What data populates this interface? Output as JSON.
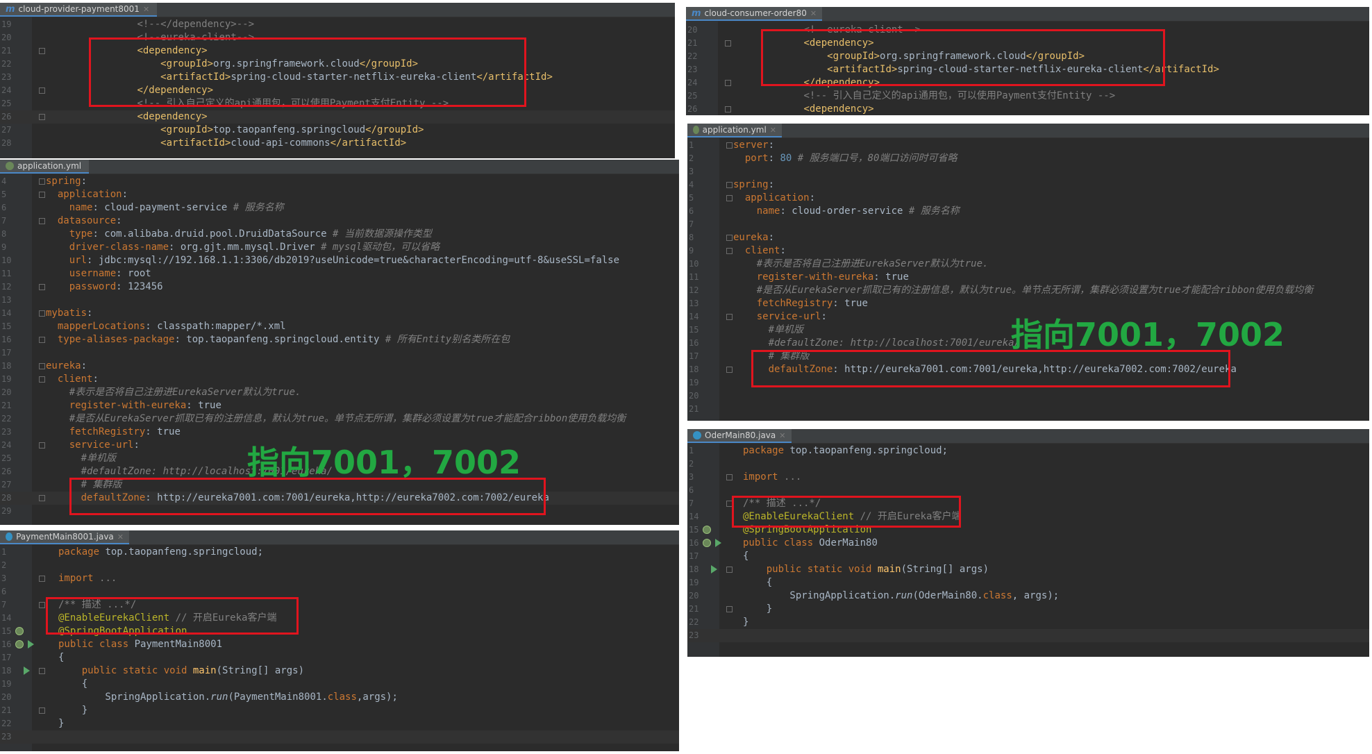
{
  "tabs": {
    "p1": "cloud-provider-payment8001",
    "p2": "application.yml",
    "p3": "PaymentMain8001.java",
    "p4": "cloud-consumer-order80",
    "p5": "application.yml",
    "p6": "OderMain80.java"
  },
  "overlay_text": "指向7001，7002",
  "colors": {
    "highlight_box": "#e0141e",
    "overlay_text": "#22a842",
    "editor_bg": "#2b2b2b"
  },
  "panels": {
    "pom_provider": [
      {
        "n": "19",
        "html": "        <span class=\"c\">&lt;!--&lt;/dependency&gt;--&gt;</span>"
      },
      {
        "n": "20",
        "html": "        <span class=\"c\">&lt;!--eureka-client--&gt;</span>"
      },
      {
        "n": "21",
        "html": "        <span class=\"t\">&lt;dependency&gt;</span>",
        "fold": true
      },
      {
        "n": "22",
        "html": "            <span class=\"t\">&lt;groupId&gt;</span>org.springframework.cloud<span class=\"t\">&lt;/groupId&gt;</span>"
      },
      {
        "n": "23",
        "html": "            <span class=\"t\">&lt;artifactId&gt;</span>spring-cloud-starter-netflix-eureka-client<span class=\"t\">&lt;/artifactId&gt;</span>"
      },
      {
        "n": "24",
        "html": "        <span class=\"t\">&lt;/dependency&gt;</span>",
        "fold": true
      },
      {
        "n": "25",
        "html": "        <span class=\"c\">&lt;!-- 引入自己定义的api通用包，可以使用Payment支付Entity --&gt;</span>"
      },
      {
        "n": "26",
        "html": "        <span class=\"t\">&lt;dependency&gt;</span>",
        "fold": true,
        "hl": true
      },
      {
        "n": "27",
        "html": "            <span class=\"t\">&lt;groupId&gt;</span>top.taopanfeng.springcloud<span class=\"t\">&lt;/groupId&gt;</span>"
      },
      {
        "n": "28",
        "html": "            <span class=\"t\">&lt;artifactId&gt;</span>cloud-api-commons<span class=\"t\">&lt;/artifactId&gt;</span>"
      }
    ],
    "yml_provider": [
      {
        "n": "4",
        "html": "<span class=\"a\">spring</span>:",
        "fold": true
      },
      {
        "n": "5",
        "html": "  <span class=\"a\">application</span>:",
        "fold": true
      },
      {
        "n": "6",
        "html": "    <span class=\"a\">name</span>: cloud-payment-service <span class=\"c it\"># 服务名称</span>"
      },
      {
        "n": "7",
        "html": "  <span class=\"a\">datasource</span>:",
        "fold": true
      },
      {
        "n": "8",
        "html": "    <span class=\"a\">type</span>: com.alibaba.druid.pool.DruidDataSource <span class=\"c it\"># 当前数据源操作类型</span>"
      },
      {
        "n": "9",
        "html": "    <span class=\"a\">driver-class-name</span>: org.gjt.mm.mysql.Driver <span class=\"c it\"># mysql驱动包，可以省略</span>"
      },
      {
        "n": "10",
        "html": "    <span class=\"a\">url</span>: jdbc:mysql://192.168.1.1:3306/db2019?useUnicode=true&amp;characterEncoding=utf-8&amp;useSSL=false"
      },
      {
        "n": "11",
        "html": "    <span class=\"a\">username</span>: root"
      },
      {
        "n": "12",
        "html": "    <span class=\"a\">password</span>: 123456",
        "fold": true
      },
      {
        "n": "13",
        "html": ""
      },
      {
        "n": "14",
        "html": "<span class=\"a\">mybatis</span>:",
        "fold": true
      },
      {
        "n": "15",
        "html": "  <span class=\"a\">mapperLocations</span>: classpath:mapper/*.xml"
      },
      {
        "n": "16",
        "html": "  <span class=\"a\">type-aliases-package</span>: top.taopanfeng.springcloud.entity <span class=\"c it\"># 所有Entity别名类所在包</span>",
        "fold": true
      },
      {
        "n": "17",
        "html": ""
      },
      {
        "n": "18",
        "html": "<span class=\"a\">eureka</span>:",
        "fold": true
      },
      {
        "n": "19",
        "html": "  <span class=\"a\">client</span>:",
        "fold": true
      },
      {
        "n": "20",
        "html": "    <span class=\"c it\">#表示是否将自己注册进EurekaServer默认为true.</span>"
      },
      {
        "n": "21",
        "html": "    <span class=\"a\">register-with-eureka</span>: true"
      },
      {
        "n": "22",
        "html": "    <span class=\"c it\">#是否从EurekaServer抓取已有的注册信息，默认为true。单节点无所谓，集群必须设置为true才能配合ribbon使用负载均衡</span>"
      },
      {
        "n": "23",
        "html": "    <span class=\"a\">fetchRegistry</span>: true"
      },
      {
        "n": "24",
        "html": "    <span class=\"a\">service-url</span>:",
        "fold": true
      },
      {
        "n": "25",
        "html": "      <span class=\"c it\">#单机版</span>"
      },
      {
        "n": "26",
        "html": "      <span class=\"c it\">#defaultZone: http://localhost:7001/eureka/</span>"
      },
      {
        "n": "27",
        "html": "      <span class=\"c it\"># 集群版</span>"
      },
      {
        "n": "28",
        "html": "      <span class=\"a\">defaultZone</span>: http://eureka7001.com:7001/eureka,http://eureka7002.com:7002/eureka",
        "fold": true,
        "hl": true
      },
      {
        "n": "29",
        "html": ""
      }
    ],
    "java_provider": [
      {
        "n": "1",
        "html": "<span class=\"k\">package</span> top.taopanfeng.springcloud;"
      },
      {
        "n": "2",
        "html": ""
      },
      {
        "n": "3",
        "html": "<span class=\"k\">import</span> <span class=\"c\">...</span>",
        "fold": true
      },
      {
        "n": "6",
        "html": ""
      },
      {
        "n": "7",
        "html": "<span class=\"c\">/** 描述 ...*/</span>",
        "fold": true
      },
      {
        "n": "14",
        "html": "<span class=\"y\">@EnableEurekaClient</span> <span class=\"c\">// 开启Eureka客户端</span>"
      },
      {
        "n": "15",
        "html": "<span class=\"y\">@SpringBootApplication</span>",
        "spring": true
      },
      {
        "n": "16",
        "html": "<span class=\"k\">public class</span> PaymentMain8001",
        "spring": true,
        "run": true
      },
      {
        "n": "17",
        "html": "{"
      },
      {
        "n": "18",
        "html": "    <span class=\"k\">public static void</span> <span class=\"fn\">main</span>(String[] args)",
        "run": true,
        "fold": true
      },
      {
        "n": "19",
        "html": "    {"
      },
      {
        "n": "20",
        "html": "        SpringApplication.<span class=\"it\">run</span>(PaymentMain8001.<span class=\"k\">class</span>,args);"
      },
      {
        "n": "21",
        "html": "    }",
        "fold": true
      },
      {
        "n": "22",
        "html": "}"
      },
      {
        "n": "23",
        "html": "",
        "hl": true
      }
    ],
    "pom_consumer": [
      {
        "n": "20",
        "html": "        <span class=\"c\">&lt;!--eureka-client--&gt;</span>"
      },
      {
        "n": "21",
        "html": "        <span class=\"t\">&lt;dependency&gt;</span>",
        "fold": true
      },
      {
        "n": "22",
        "html": "            <span class=\"t\">&lt;groupId&gt;</span>org.springframework.cloud<span class=\"t\">&lt;/groupId&gt;</span>"
      },
      {
        "n": "23",
        "html": "            <span class=\"t\">&lt;artifactId&gt;</span>spring-cloud-starter-netflix-eureka-client<span class=\"t\">&lt;/artifactId&gt;</span>"
      },
      {
        "n": "24",
        "html": "        <span class=\"t\">&lt;/dependency&gt;</span>",
        "fold": true
      },
      {
        "n": "25",
        "html": "        <span class=\"c\">&lt;!-- 引入自己定义的api通用包，可以使用Payment支付Entity --&gt;</span>"
      },
      {
        "n": "26",
        "html": "        <span class=\"t\">&lt;dependency&gt;</span>",
        "fold": true
      }
    ],
    "yml_consumer": [
      {
        "n": "1",
        "html": "<span class=\"a\">server</span>:",
        "fold": true
      },
      {
        "n": "2",
        "html": "  <span class=\"a\">port</span>: <span class=\"n\">80</span> <span class=\"c it\"># 服务端口号，80端口访问时可省略</span>"
      },
      {
        "n": "3",
        "html": ""
      },
      {
        "n": "4",
        "html": "<span class=\"a\">spring</span>:",
        "fold": true
      },
      {
        "n": "5",
        "html": "  <span class=\"a\">application</span>:",
        "fold": true
      },
      {
        "n": "6",
        "html": "    <span class=\"a\">name</span>: cloud-order-service <span class=\"c it\"># 服务名称</span>"
      },
      {
        "n": "7",
        "html": ""
      },
      {
        "n": "8",
        "html": "<span class=\"a\">eureka</span>:",
        "fold": true
      },
      {
        "n": "9",
        "html": "  <span class=\"a\">client</span>:",
        "fold": true
      },
      {
        "n": "10",
        "html": "    <span class=\"c it\">#表示是否将自己注册进EurekaServer默认为true.</span>"
      },
      {
        "n": "11",
        "html": "    <span class=\"a\">register-with-eureka</span>: true"
      },
      {
        "n": "12",
        "html": "    <span class=\"c it\">#是否从EurekaServer抓取已有的注册信息，默认为true。单节点无所谓，集群必须设置为true才能配合ribbon使用负载均衡</span>"
      },
      {
        "n": "13",
        "html": "    <span class=\"a\">fetchRegistry</span>: true"
      },
      {
        "n": "14",
        "html": "    <span class=\"a\">service-url</span>:",
        "fold": true
      },
      {
        "n": "15",
        "html": "      <span class=\"c it\">#单机版</span>"
      },
      {
        "n": "16",
        "html": "      <span class=\"c it\">#defaultZone: http://localhost:7001/eureka/</span>"
      },
      {
        "n": "17",
        "html": "      <span class=\"c it\"># 集群版</span>"
      },
      {
        "n": "18",
        "html": "      <span class=\"a\">defaultZone</span>: http://eureka7001.com:7001/eureka,http://eureka7002.com:7002/eureka",
        "fold": true
      },
      {
        "n": "19",
        "html": ""
      },
      {
        "n": "20",
        "html": ""
      },
      {
        "n": "21",
        "html": ""
      }
    ],
    "java_consumer": [
      {
        "n": "1",
        "html": "<span class=\"k\">package</span> top.taopanfeng.springcloud;"
      },
      {
        "n": "2",
        "html": ""
      },
      {
        "n": "3",
        "html": "<span class=\"k\">import</span> <span class=\"c\">...</span>",
        "fold": true
      },
      {
        "n": "6",
        "html": ""
      },
      {
        "n": "7",
        "html": "<span class=\"c\">/** 描述 ...*/</span>",
        "fold": true
      },
      {
        "n": "14",
        "html": "<span class=\"y\">@EnableEurekaClient</span> <span class=\"c\">// 开启Eureka客户端</span>"
      },
      {
        "n": "15",
        "html": "<span class=\"y\">@SpringBootApplication</span>",
        "spring": true
      },
      {
        "n": "16",
        "html": "<span class=\"k\">public class</span> OderMain80",
        "spring": true,
        "run": true
      },
      {
        "n": "17",
        "html": "{"
      },
      {
        "n": "18",
        "html": "    <span class=\"k\">public static void</span> <span class=\"fn\">main</span>(String[] args)",
        "run": true,
        "fold": true
      },
      {
        "n": "19",
        "html": "    {"
      },
      {
        "n": "20",
        "html": "        SpringApplication.<span class=\"it\">run</span>(OderMain80.<span class=\"k\">class</span>, args);"
      },
      {
        "n": "21",
        "html": "    }",
        "fold": true
      },
      {
        "n": "22",
        "html": "}"
      },
      {
        "n": "23",
        "html": "",
        "hl": true
      }
    ]
  }
}
